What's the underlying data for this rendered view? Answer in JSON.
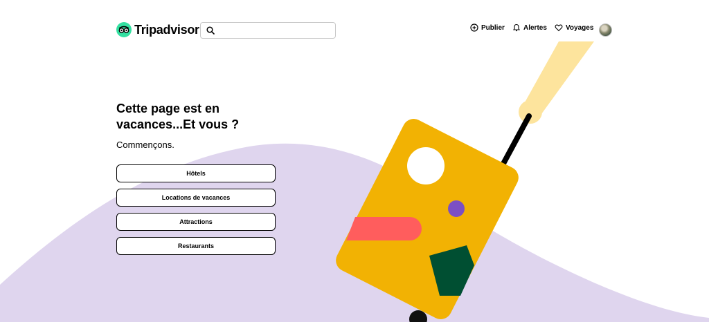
{
  "brand": {
    "name": "Tripadvisor",
    "accent": "#34E0A1"
  },
  "search": {
    "placeholder": "",
    "value": ""
  },
  "nav": {
    "publish": "Publier",
    "alerts": "Alertes",
    "trips": "Voyages"
  },
  "hero": {
    "title": "Cette page est en vacances...Et vous ?",
    "subtitle": "Commençons."
  },
  "options": [
    {
      "label": "Hôtels"
    },
    {
      "label": "Locations de vacances"
    },
    {
      "label": "Attractions"
    },
    {
      "label": "Restaurants"
    }
  ],
  "colors": {
    "wave": "#DFD5EE",
    "suitcase": "#F2B203",
    "hand": "#FDE49D",
    "pink": "#FF5D5D",
    "purple": "#7C4FC4",
    "green": "#004F32"
  },
  "icons": {
    "logo": "owl-eyes-icon",
    "search": "search-icon",
    "publish": "plus-circle-icon",
    "alerts": "bell-icon",
    "trips": "heart-icon"
  }
}
